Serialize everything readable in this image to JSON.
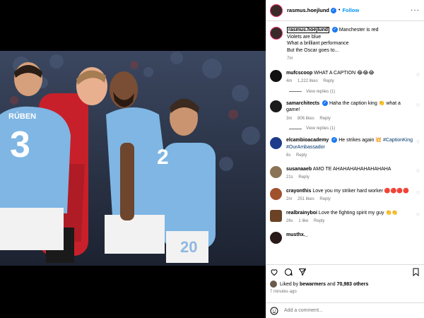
{
  "post": {
    "username": "rasmus.hoejlund",
    "follow_label": "Follow",
    "caption": {
      "username": "rasmus.hoejlund",
      "lines": [
        "Manchester is red",
        "Violets are blue",
        "What a brilliant performance",
        "But the Oscar goes to..."
      ],
      "time": "7m"
    },
    "liked_by_prefix": "Liked by",
    "liked_by_user": "bewarmers",
    "liked_by_and": "and",
    "liked_by_others": "70,983 others",
    "posted_ago": "7 minutes ago",
    "add_comment_placeholder": "Add a comment..."
  },
  "photo": {
    "player_left_name": "RÚBEN",
    "player_left_number": "3",
    "player_center_number": "2",
    "player_right_number": "20"
  },
  "comments": [
    {
      "user": "mufcscoop",
      "text": "WHAT A CAPTION 😂😂😂",
      "time": "4m",
      "likes": "1,222 likes",
      "reply": "Reply",
      "view_replies": "View replies (1)"
    },
    {
      "user": "samarchitects",
      "text": "Haha the caption king 👏 what a game!",
      "time": "3m",
      "likes": "806 likes",
      "reply": "Reply",
      "view_replies": "View replies (1)"
    },
    {
      "user": "elcambioacademy",
      "text": "He strikes again 💥 ",
      "tags": "#CaptionKing #OurAmbassador",
      "time": "6s",
      "reply": "Reply"
    },
    {
      "user": "susanaaeb",
      "text": "AMO TE AHAHAHAHAHAHAHAHA",
      "time": "21s",
      "reply": "Reply"
    },
    {
      "user": "crayonthis",
      "text": "Love you my striker hard worker ",
      "red": "🔴🔴🔴🔴",
      "time": "2m",
      "likes": "251 likes",
      "reply": "Reply"
    },
    {
      "user": "realbrainyboi",
      "text": "Love the fighting spirit my guy 👏👏",
      "time": "26s",
      "likes": "1 like",
      "reply": "Reply"
    },
    {
      "user": "musthx._",
      "text": ""
    }
  ],
  "colors": {
    "accent_blue": "#0095f6",
    "city_blue": "#6cabdd",
    "united_red": "#da291c"
  }
}
